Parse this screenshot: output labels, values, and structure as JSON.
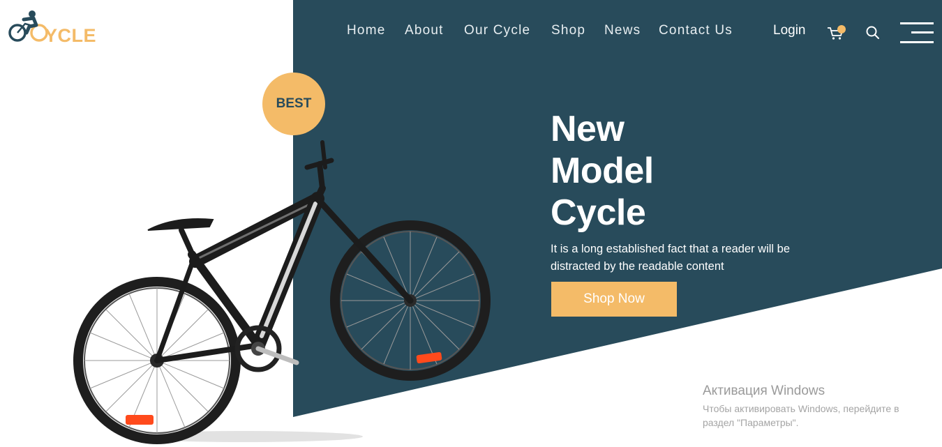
{
  "logo": {
    "text": "YCLE",
    "icon": "cyclist-logo-icon"
  },
  "nav": {
    "items": [
      {
        "label": "Home"
      },
      {
        "label": "About"
      },
      {
        "label": "Our Cycle"
      },
      {
        "label": "Shop"
      },
      {
        "label": "News"
      },
      {
        "label": "Contact Us"
      }
    ],
    "login": "Login",
    "cart_icon": "cart-icon",
    "search_icon": "search-icon",
    "menu_icon": "hamburger-menu-icon"
  },
  "badge": {
    "label": "BEST"
  },
  "hero": {
    "title_lines": [
      "New",
      "Model",
      "Cycle"
    ],
    "description_lines": [
      "It is a long established fact that a reader will be",
      "distracted by the readable content"
    ],
    "cta": "Shop Now"
  },
  "watermark": {
    "title": "Активация Windows",
    "line1": "Чтобы активировать Windows, перейдите в",
    "line2": "раздел \"Параметры\"."
  },
  "colors": {
    "primary": "#284b5b",
    "accent": "#f4bb68",
    "background": "#ffffff"
  }
}
